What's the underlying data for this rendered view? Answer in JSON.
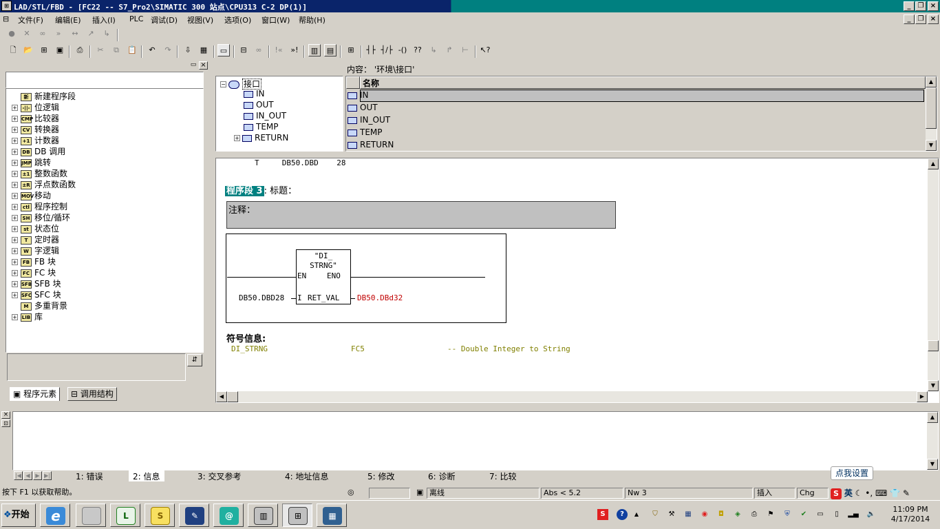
{
  "window": {
    "title": "LAD/STL/FBD  - [FC22 -- S7_Pro2\\SIMATIC 300 站点\\CPU313 C-2 DP(1)]",
    "app_icon": "lad-app-icon"
  },
  "menu": [
    "文件(F)",
    "编辑(E)",
    "插入(I)",
    "PLC",
    "调试(D)",
    "视图(V)",
    "选项(O)",
    "窗口(W)",
    "帮助(H)"
  ],
  "left_tree": [
    {
      "label": "新建程序段",
      "icon": "新",
      "expand": false
    },
    {
      "label": "位逻辑",
      "icon": "-||-",
      "expand": true
    },
    {
      "label": "比较器",
      "icon": "CMP",
      "expand": true
    },
    {
      "label": "转换器",
      "icon": "CV",
      "expand": true
    },
    {
      "label": "计数器",
      "icon": "+1",
      "expand": true
    },
    {
      "label": "DB 调用",
      "icon": "DB",
      "expand": true
    },
    {
      "label": "跳转",
      "icon": "JMP",
      "expand": true
    },
    {
      "label": "整数函数",
      "icon": "±1",
      "expand": true
    },
    {
      "label": "浮点数函数",
      "icon": "±R",
      "expand": true
    },
    {
      "label": "移动",
      "icon": "MOV",
      "expand": true
    },
    {
      "label": "程序控制",
      "icon": "ctl",
      "expand": true
    },
    {
      "label": "移位/循环",
      "icon": "SH",
      "expand": true
    },
    {
      "label": "状态位",
      "icon": "st",
      "expand": true
    },
    {
      "label": "定时器",
      "icon": "T",
      "expand": true
    },
    {
      "label": "字逻辑",
      "icon": "W",
      "expand": true
    },
    {
      "label": "FB 块",
      "icon": "FB",
      "expand": true
    },
    {
      "label": "FC 块",
      "icon": "FC",
      "expand": true
    },
    {
      "label": "SFB 块",
      "icon": "SFB",
      "expand": true
    },
    {
      "label": "SFC 块",
      "icon": "SFC",
      "expand": true
    },
    {
      "label": "多重背景",
      "icon": "M",
      "expand": false
    },
    {
      "label": "库",
      "icon": "LIB",
      "expand": true
    }
  ],
  "left_tabs": [
    "程序元素",
    "调用结构"
  ],
  "interface": {
    "root": "接口",
    "items": [
      "IN",
      "OUT",
      "IN_OUT",
      "TEMP",
      "RETURN"
    ],
    "content_label": "内容：  '环境\\接口'",
    "column_name": "名称",
    "rows": [
      "IN",
      "OUT",
      "IN_OUT",
      "TEMP",
      "RETURN"
    ]
  },
  "editor": {
    "prev_line": "T     DB50.DBD    28",
    "network_label": "程序段 3",
    "title_label": ": 标题：",
    "comment_label": "注释：",
    "block": {
      "name_line1": "\"DI_",
      "name_line2": "STRNG\"",
      "en": "EN",
      "eno": "ENO",
      "input_pin": "I",
      "output_pin": "RET_VAL",
      "input_operand": "DB50.DBD28",
      "output_operand": "DB50.DBd32"
    },
    "symbol_info_label": "符号信息:",
    "symbol": {
      "name": "DI_STRNG",
      "block": "FC5",
      "comment": "-- Double Integer to String"
    }
  },
  "bottom_tabs": [
    "1: 错误",
    "2: 信息",
    "3: 交叉参考",
    "4: 地址信息",
    "5: 修改",
    "6: 诊断",
    "7: 比较"
  ],
  "status": {
    "help": "按下 F1 以获取帮助。",
    "mode": "离线",
    "abs": "Abs < 5.2",
    "nw": "Nw 3",
    "insert": "插入",
    "chg": "Chg"
  },
  "ime": {
    "lang": "英",
    "tooltip": "点我设置"
  },
  "taskbar": {
    "start": "开始",
    "time": "11:09 PM",
    "date": "4/17/2014"
  },
  "colors": {
    "titlebar": "#0a246a",
    "network_highlight": "#008080",
    "output_operand": "#c00000",
    "symbol_text": "#808000"
  }
}
